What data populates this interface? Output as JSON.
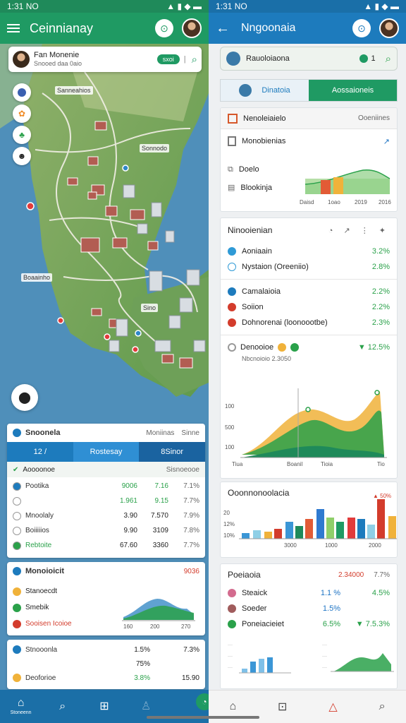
{
  "left": {
    "status": {
      "time": "1:31 NO",
      "right": "▲ ▮ ◆ ▬"
    },
    "appbar": {
      "title": "Ceinnianay"
    },
    "search": {
      "title": "Fan Monenie",
      "subtitle": "Snooed daa 0aio",
      "pill": "sxoi"
    },
    "map_labels": {
      "a": "Sanneahios",
      "b": "Sonnodo",
      "c": "Boaainho",
      "d": "Sino"
    },
    "card1": {
      "title": "Snoonela",
      "meta": "Moniinas",
      "meta2": "Sinne",
      "tabs": [
        "12 /",
        "Rostesay",
        "8Sinor"
      ],
      "subhead": "Aoooonoe",
      "subhead_right": "Sisnoeooe",
      "rows": [
        {
          "label": "Pootika",
          "a": "9006",
          "b": "7.16",
          "c": "7.1%"
        },
        {
          "label": "",
          "a": "1.961",
          "b": "9.15",
          "c": "7.7%"
        },
        {
          "label": "Mnoolaly",
          "a": "3.90",
          "b": "7.570",
          "c": "7.9%"
        },
        {
          "label": "Boiiiiios",
          "a": "9.90",
          "b": "3109",
          "c": "7.8%"
        },
        {
          "label": "Rebtoite",
          "a": "67.60",
          "b": "3360",
          "c": "7.7%"
        }
      ]
    },
    "card2": {
      "title": "Monoioicit",
      "right": "9036",
      "rows": [
        "Stanoecdt",
        "Smebik",
        "Sooisen Icoioe"
      ],
      "ticks": [
        "160",
        "200",
        "270"
      ]
    },
    "card3": {
      "rows": [
        {
          "label": "Stnooonla",
          "a": "1.5%",
          "b": "7.3%"
        },
        {
          "label": "",
          "a": "75%",
          "b": ""
        },
        {
          "label": "Deoforioe",
          "a": "3.8%",
          "b": "15.90"
        }
      ]
    },
    "nav": [
      "Stoneenn",
      "",
      "",
      "",
      ""
    ]
  },
  "right": {
    "status": {
      "time": "1:31 NO",
      "right": "▲ ▮ ◆ ▬"
    },
    "appbar": {
      "title": "Nngoonaia"
    },
    "search": {
      "text": "Rauoloiaona",
      "count": "1"
    },
    "seg": [
      "Dinatoia",
      "Aossaioneis"
    ],
    "summary": {
      "head": "Nenoleiaielo",
      "head_right": "Ooeniines",
      "items": [
        "Monobienias",
        "Doelo",
        "Blookinja"
      ],
      "axis": [
        "Daisd",
        "1oao",
        "2019",
        "2016"
      ]
    },
    "metrics": {
      "title": "Ninooienian",
      "g1": [
        {
          "label": "Aoniaain",
          "v": "3.2%"
        },
        {
          "label": "Nystaion (Oreeniio)",
          "v": "2.8%"
        }
      ],
      "g2": [
        {
          "label": "Camalaioia",
          "v": "2.2%"
        },
        {
          "label": "Soiion",
          "v": "2.2%"
        },
        {
          "label": "Dohnorenai (loonoootbe)",
          "v": "2.3%"
        }
      ],
      "g3": {
        "title": "Denooioe",
        "sub": "Nbcnoioio 2.3050",
        "v": "▼ 12.5%"
      },
      "y": [
        "100",
        "500",
        "100"
      ],
      "x": [
        "Tiua",
        "Boanil",
        "Tioia",
        "Tio"
      ]
    },
    "bars": {
      "title": "Ooonnonoolacia",
      "label": "▲ 50%",
      "y": [
        "20",
        "12%",
        "10%"
      ],
      "x": [
        "3000",
        "1000",
        "2000"
      ]
    },
    "last": {
      "title": "Poeiaoia",
      "right1": "2.34000",
      "right2": "7.7%",
      "rows": [
        {
          "label": "Steaick",
          "a": "1.1 %",
          "b": "4.5%"
        },
        {
          "label": "Soeder",
          "a": "1.5%",
          "b": ""
        },
        {
          "label": "Poneiacieiet",
          "a": "6.5%",
          "b": "▼ 7.5.3%"
        }
      ]
    }
  }
}
